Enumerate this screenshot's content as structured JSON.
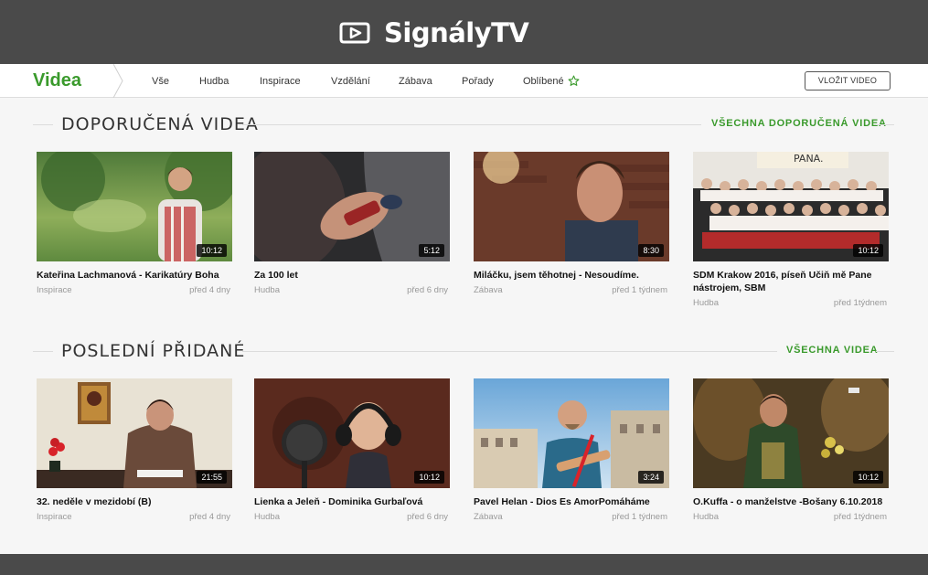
{
  "brand": {
    "name": "SignályTV"
  },
  "nav": {
    "title": "Videa",
    "items": [
      "Vše",
      "Hudba",
      "Inspirace",
      "Vzdělání",
      "Zábava",
      "Pořady",
      "Oblíbené"
    ],
    "upload_label": "VLOŽIT VIDEO"
  },
  "sections": [
    {
      "title": "DOPORUČENÁ VIDEA",
      "link": "VŠECHNA DOPORUČENÁ VIDEA",
      "videos": [
        {
          "title": "Kateřina Lachmanová - Karikatúry Boha",
          "category": "Inspirace",
          "date": "před 4 dny",
          "duration": "10:12"
        },
        {
          "title": "Za 100 let",
          "category": "Hudba",
          "date": "před 6 dny",
          "duration": "5:12"
        },
        {
          "title": "Miláčku, jsem těhotnej - Nesoudíme.",
          "category": "Zábava",
          "date": "před 1 týdnem",
          "duration": "8:30"
        },
        {
          "title": "SDM Krakow 2016, píseň Učiň mě Pane nástrojem, SBM",
          "category": "Hudba",
          "date": "před 1týdnem",
          "duration": "10:12"
        }
      ]
    },
    {
      "title": "POSLEDNÍ PŘIDANÉ",
      "link": "VŠECHNA VIDEA",
      "videos": [
        {
          "title": "32. neděle v mezidobí (B)",
          "category": "Inspirace",
          "date": "před 4 dny",
          "duration": "21:55"
        },
        {
          "title": "Lienka a Jeleň - Dominika Gurbaľová",
          "category": "Hudba",
          "date": "před 6 dny",
          "duration": "10:12"
        },
        {
          "title": "Pavel Helan - Dios Es AmorPomáháme",
          "category": "Zábava",
          "date": "před 1 týdnem",
          "duration": "3:24"
        },
        {
          "title": "O.Kuffa - o manželstve -Bošany 6.10.2018",
          "category": "Hudba",
          "date": "před 1týdnem",
          "duration": "10:12"
        }
      ]
    }
  ],
  "thumbnail_text": {
    "poster_word": "PANA."
  },
  "colors": {
    "accent": "#3a9a2c",
    "topbar": "#4a4a4a"
  }
}
